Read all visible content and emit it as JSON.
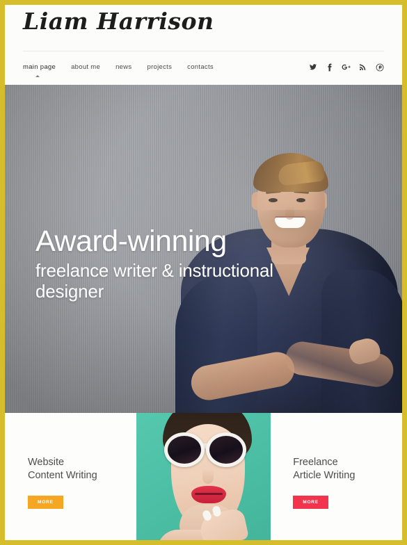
{
  "site": {
    "logo": "Liam Harrison",
    "accent_gold": "#d6bd2b",
    "accent_orange": "#f5a623",
    "accent_red": "#f2344d",
    "accent_teal": "#4cbfa5"
  },
  "nav": {
    "items": [
      {
        "label": "main page",
        "active": true
      },
      {
        "label": "about me",
        "active": false
      },
      {
        "label": "news",
        "active": false
      },
      {
        "label": "projects",
        "active": false
      },
      {
        "label": "contacts",
        "active": false
      }
    ]
  },
  "social": {
    "items": [
      {
        "name": "twitter-icon"
      },
      {
        "name": "facebook-icon"
      },
      {
        "name": "google-plus-icon"
      },
      {
        "name": "rss-icon"
      },
      {
        "name": "pinterest-icon"
      }
    ]
  },
  "hero": {
    "headline": "Award-winning",
    "subheadline": "freelance writer & instructional designer",
    "image_alt": "smiling man in navy v-neck t-shirt with arms crossed against grey wall"
  },
  "services": {
    "left": {
      "title": "Website\nContent Writing",
      "button": "MORE",
      "button_color": "#f5a623"
    },
    "photo": {
      "image_alt": "woman wearing oversized white sunglasses with red lips on teal background"
    },
    "right": {
      "title": "Freelance\nArticle Writing",
      "button": "MORE",
      "button_color": "#f2344d"
    }
  }
}
